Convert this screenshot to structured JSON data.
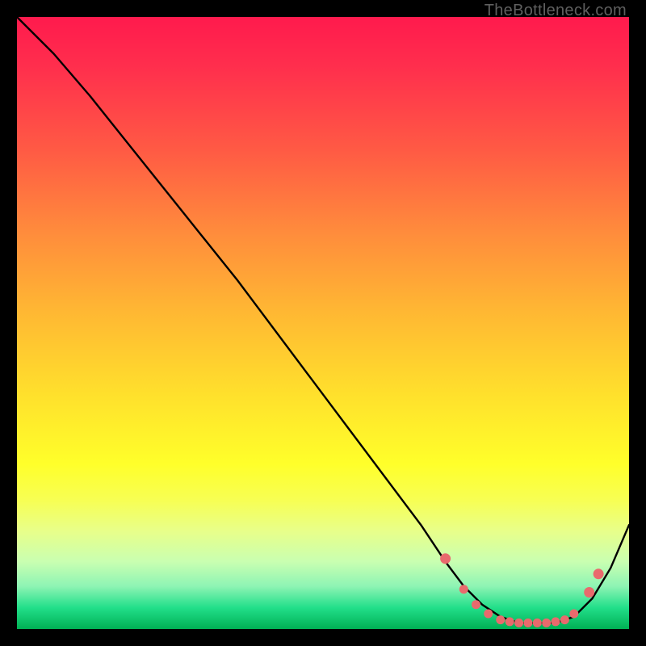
{
  "watermark": "TheBottleneck.com",
  "chart_data": {
    "type": "line",
    "title": "",
    "xlabel": "",
    "ylabel": "",
    "xlim": [
      0,
      100
    ],
    "ylim": [
      0,
      100
    ],
    "series": [
      {
        "name": "curve",
        "x": [
          0,
          6,
          12,
          18,
          24,
          30,
          36,
          42,
          48,
          54,
          60,
          66,
          70,
          73,
          76,
          79,
          82,
          85,
          88,
          91,
          94,
          97,
          100
        ],
        "y": [
          100,
          94,
          87,
          79.5,
          72,
          64.5,
          57,
          49,
          41,
          33,
          25,
          17,
          11,
          7,
          4,
          2,
          1,
          1,
          1,
          2,
          5,
          10,
          17
        ]
      }
    ],
    "markers": {
      "name": "highlight-dots",
      "color_hex": "#e96a6d",
      "x": [
        70,
        73,
        75,
        77,
        79,
        80.5,
        82,
        83.5,
        85,
        86.5,
        88,
        89.5,
        91,
        93.5,
        95
      ],
      "y": [
        11.5,
        6.5,
        4,
        2.5,
        1.5,
        1.2,
        1,
        1,
        1,
        1,
        1.2,
        1.5,
        2.5,
        6,
        9
      ]
    },
    "colors": {
      "curve": "#000000",
      "marker": "#e96a6d",
      "gradient_top": "#ff1a4d",
      "gradient_bottom": "#00b054"
    }
  }
}
